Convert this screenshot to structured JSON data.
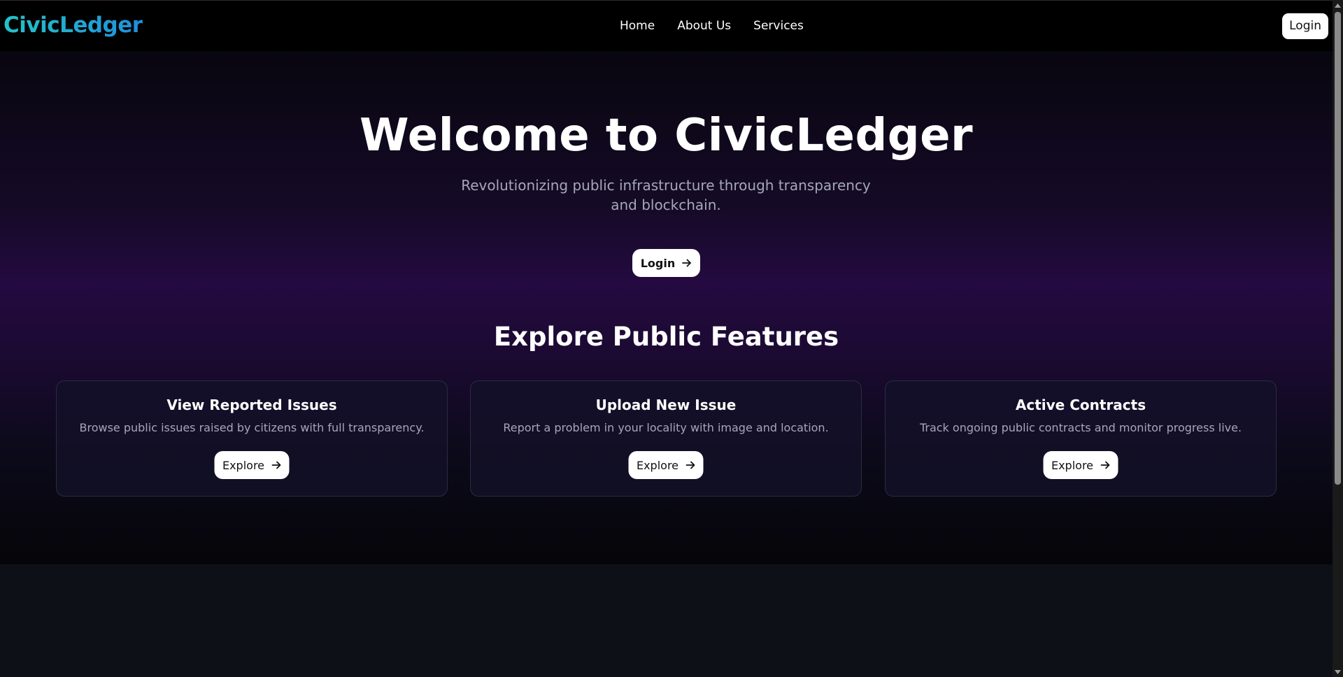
{
  "navbar": {
    "logo": "CivicLedger",
    "links": [
      "Home",
      "About Us",
      "Services"
    ],
    "login_label": "Login"
  },
  "hero": {
    "title": "Welcome to CivicLedger",
    "subtitle": "Revolutionizing public infrastructure through transparency and blockchain.",
    "login_label": "Login"
  },
  "features": {
    "heading": "Explore Public Features",
    "cards": [
      {
        "title": "View Reported Issues",
        "description": "Browse public issues raised by citizens with full transparency.",
        "button_label": "Explore"
      },
      {
        "title": "Upload New Issue",
        "description": "Report a problem in your locality with image and location.",
        "button_label": "Explore"
      },
      {
        "title": "Active Contracts",
        "description": "Track ongoing public contracts and monitor progress live.",
        "button_label": "Explore"
      }
    ]
  },
  "icons": {
    "button_arrow": "arrow-right-icon"
  },
  "colors": {
    "logo_gradient_start": "#22c4c8",
    "logo_gradient_end": "#1f8fdc",
    "hero_glow": "#240a40",
    "page_bg": "#0d1117",
    "muted_text": "#a6a6bb"
  }
}
